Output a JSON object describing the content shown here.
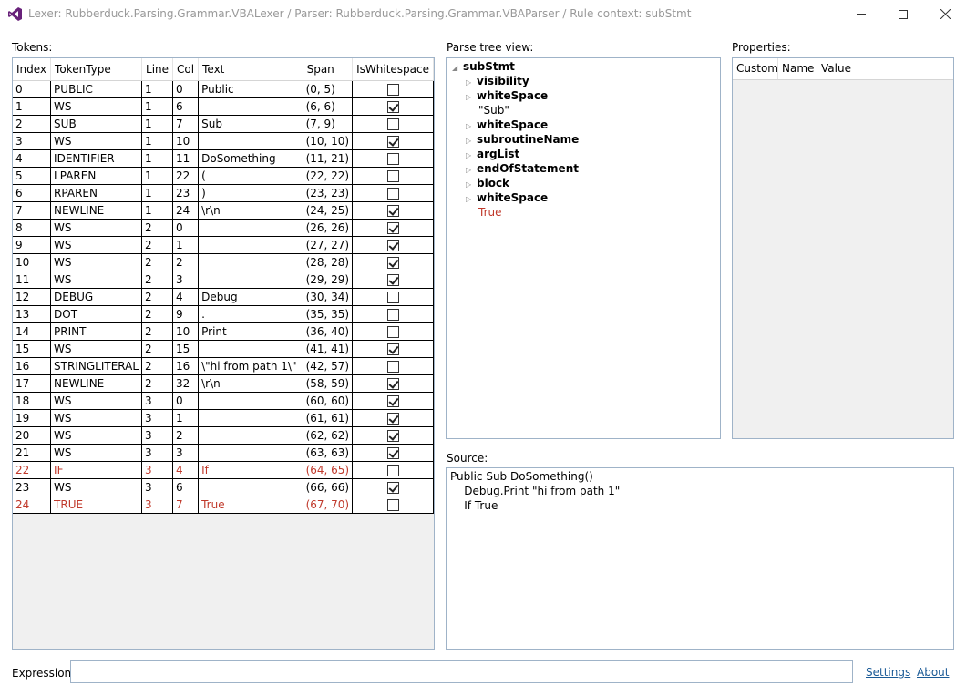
{
  "window": {
    "title": "Lexer: Rubberduck.Parsing.Grammar.VBALexer  /  Parser: Rubberduck.Parsing.Grammar.VBAParser  /  Rule context: subStmt"
  },
  "labels": {
    "tokens": "Tokens:",
    "parse_tree": "Parse tree view:",
    "properties": "Properties:",
    "source": "Source:",
    "expression": "Expression:"
  },
  "tokens": {
    "columns": [
      "Index",
      "TokenType",
      "Line",
      "Col",
      "Text",
      "Span",
      "IsWhitespace"
    ],
    "rows": [
      {
        "index": "0",
        "type": "PUBLIC",
        "line": "1",
        "col": "0",
        "text": "Public",
        "span": "(0, 5)",
        "ws": false,
        "error": false
      },
      {
        "index": "1",
        "type": "WS",
        "line": "1",
        "col": "6",
        "text": "",
        "span": "(6, 6)",
        "ws": true,
        "error": false
      },
      {
        "index": "2",
        "type": "SUB",
        "line": "1",
        "col": "7",
        "text": "Sub",
        "span": "(7, 9)",
        "ws": false,
        "error": false
      },
      {
        "index": "3",
        "type": "WS",
        "line": "1",
        "col": "10",
        "text": "",
        "span": "(10, 10)",
        "ws": true,
        "error": false
      },
      {
        "index": "4",
        "type": "IDENTIFIER",
        "line": "1",
        "col": "11",
        "text": "DoSomething",
        "span": "(11, 21)",
        "ws": false,
        "error": false
      },
      {
        "index": "5",
        "type": "LPAREN",
        "line": "1",
        "col": "22",
        "text": "(",
        "span": "(22, 22)",
        "ws": false,
        "error": false
      },
      {
        "index": "6",
        "type": "RPAREN",
        "line": "1",
        "col": "23",
        "text": ")",
        "span": "(23, 23)",
        "ws": false,
        "error": false
      },
      {
        "index": "7",
        "type": "NEWLINE",
        "line": "1",
        "col": "24",
        "text": "\\r\\n",
        "span": "(24, 25)",
        "ws": true,
        "error": false
      },
      {
        "index": "8",
        "type": "WS",
        "line": "2",
        "col": "0",
        "text": "",
        "span": "(26, 26)",
        "ws": true,
        "error": false
      },
      {
        "index": "9",
        "type": "WS",
        "line": "2",
        "col": "1",
        "text": "",
        "span": "(27, 27)",
        "ws": true,
        "error": false
      },
      {
        "index": "10",
        "type": "WS",
        "line": "2",
        "col": "2",
        "text": "",
        "span": "(28, 28)",
        "ws": true,
        "error": false
      },
      {
        "index": "11",
        "type": "WS",
        "line": "2",
        "col": "3",
        "text": "",
        "span": "(29, 29)",
        "ws": true,
        "error": false
      },
      {
        "index": "12",
        "type": "DEBUG",
        "line": "2",
        "col": "4",
        "text": "Debug",
        "span": "(30, 34)",
        "ws": false,
        "error": false
      },
      {
        "index": "13",
        "type": "DOT",
        "line": "2",
        "col": "9",
        "text": ".",
        "span": "(35, 35)",
        "ws": false,
        "error": false
      },
      {
        "index": "14",
        "type": "PRINT",
        "line": "2",
        "col": "10",
        "text": "Print",
        "span": "(36, 40)",
        "ws": false,
        "error": false
      },
      {
        "index": "15",
        "type": "WS",
        "line": "2",
        "col": "15",
        "text": "",
        "span": "(41, 41)",
        "ws": true,
        "error": false
      },
      {
        "index": "16",
        "type": "STRINGLITERAL",
        "line": "2",
        "col": "16",
        "text": "\\\"hi from path 1\\\"",
        "span": "(42, 57)",
        "ws": false,
        "error": false
      },
      {
        "index": "17",
        "type": "NEWLINE",
        "line": "2",
        "col": "32",
        "text": "\\r\\n",
        "span": "(58, 59)",
        "ws": true,
        "error": false
      },
      {
        "index": "18",
        "type": "WS",
        "line": "3",
        "col": "0",
        "text": "",
        "span": "(60, 60)",
        "ws": true,
        "error": false
      },
      {
        "index": "19",
        "type": "WS",
        "line": "3",
        "col": "1",
        "text": "",
        "span": "(61, 61)",
        "ws": true,
        "error": false
      },
      {
        "index": "20",
        "type": "WS",
        "line": "3",
        "col": "2",
        "text": "",
        "span": "(62, 62)",
        "ws": true,
        "error": false
      },
      {
        "index": "21",
        "type": "WS",
        "line": "3",
        "col": "3",
        "text": "",
        "span": "(63, 63)",
        "ws": true,
        "error": false
      },
      {
        "index": "22",
        "type": "IF",
        "line": "3",
        "col": "4",
        "text": "If",
        "span": "(64, 65)",
        "ws": false,
        "error": true
      },
      {
        "index": "23",
        "type": "WS",
        "line": "3",
        "col": "6",
        "text": "",
        "span": "(66, 66)",
        "ws": true,
        "error": false
      },
      {
        "index": "24",
        "type": "TRUE",
        "line": "3",
        "col": "7",
        "text": "True",
        "span": "(67, 70)",
        "ws": false,
        "error": true
      }
    ]
  },
  "tree": {
    "root": "subStmt",
    "children": [
      {
        "label": "visibility",
        "kind": "node"
      },
      {
        "label": "whiteSpace",
        "kind": "node"
      },
      {
        "label": "\"Sub\"",
        "kind": "terminal"
      },
      {
        "label": "whiteSpace",
        "kind": "node"
      },
      {
        "label": "subroutineName",
        "kind": "node"
      },
      {
        "label": "argList",
        "kind": "node"
      },
      {
        "label": "endOfStatement",
        "kind": "node"
      },
      {
        "label": "block",
        "kind": "node"
      },
      {
        "label": "whiteSpace",
        "kind": "node"
      },
      {
        "label": "True",
        "kind": "error"
      }
    ]
  },
  "properties": {
    "columns": [
      "Custom",
      "Name",
      "Value"
    ]
  },
  "source": {
    "lines": [
      "Public Sub DoSomething()",
      "    Debug.Print \"hi from path 1\"",
      "    If True"
    ]
  },
  "expression": {
    "value": ""
  },
  "links": {
    "settings": "Settings",
    "about": "About"
  },
  "colors": {
    "error_text": "#c0392b",
    "panel_border": "#9fb3c8",
    "link": "#1a5a96",
    "app_icon": "#68217a"
  },
  "icons": [
    "visual-studio-icon",
    "minimize-icon",
    "maximize-icon",
    "close-icon",
    "expand-arrow-icon",
    "collapse-arrow-icon",
    "checkbox"
  ]
}
